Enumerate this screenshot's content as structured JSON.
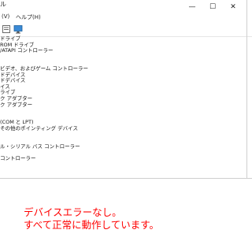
{
  "window": {
    "title_fragment": "ル",
    "controls": {
      "minimize": "—",
      "maximize": "☐",
      "close": "✕"
    }
  },
  "menu": [
    {
      "label": "(V)"
    },
    {
      "label": "ヘルプ(H)"
    }
  ],
  "toolbar": {
    "icons": [
      "show-properties-icon",
      "monitor-icon"
    ]
  },
  "tree_rows": [
    "ドライブ",
    "ROM ドライブ",
    "/ATAPI コントローラー",
    "",
    "",
    "ビデオ、およびゲーム コントローラー",
    "ドデバイス",
    "ドデバイス",
    "イス",
    "ライブ",
    "ク アダプター",
    "ク アダプター",
    "",
    "",
    "(COM と LPT)",
    "その他のポインティング デバイス",
    "",
    "",
    "ル・シリアル バス コントローラー",
    "",
    "コントローラー"
  ],
  "message": {
    "line1": "デバイスエラーなし。",
    "line2": "すべて正常に動作しています。",
    "color": "#ff0000"
  }
}
